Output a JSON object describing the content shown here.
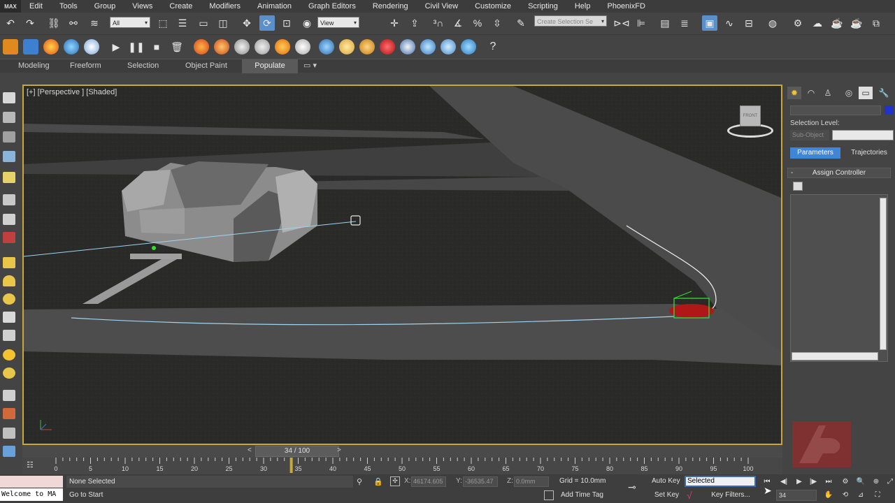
{
  "app": {
    "logo_text": "MAX"
  },
  "menu": [
    "Edit",
    "Tools",
    "Group",
    "Views",
    "Create",
    "Modifiers",
    "Animation",
    "Graph Editors",
    "Rendering",
    "Civil View",
    "Customize",
    "Scripting",
    "Help",
    "PhoenixFD"
  ],
  "toolbar": {
    "selection_filter": "All",
    "reference_coord": "View",
    "named_selection_placeholder": "Create Selection Se"
  },
  "ribbon": {
    "tabs": [
      "Modeling",
      "Freeform",
      "Selection",
      "Object Paint",
      "Populate"
    ],
    "active_tab": "Populate"
  },
  "viewport": {
    "label": "[+] [Perspective ] [Shaded]",
    "viewcube_label": "FRONT"
  },
  "command_panel": {
    "selection_level_label": "Selection Level:",
    "sub_object_label": "Sub-Object",
    "tab_parameters": "Parameters",
    "tab_trajectories": "Trajectories",
    "rollout_minus": "-",
    "rollout_title": "Assign Controller",
    "object_color": "#2233cc"
  },
  "timeline": {
    "position_label": "34 / 100",
    "current_frame": 34,
    "total_frames": 100,
    "prev_arrow": "<",
    "next_arrow": ">",
    "ticks": [
      "0",
      "5",
      "10",
      "15",
      "20",
      "25",
      "30",
      "35",
      "40",
      "45",
      "50",
      "55",
      "60",
      "65",
      "70",
      "75",
      "80",
      "85",
      "90",
      "95",
      "100"
    ]
  },
  "status": {
    "maxscript_text": "Welcome to MA",
    "selection_status": "None Selected",
    "prompt": "Go to Start",
    "x_label": "X:",
    "x_value": "46174.605",
    "y_label": "Y:",
    "y_value": "-36535.47",
    "z_label": "Z:",
    "z_value": "0.0mm",
    "grid": "Grid = 10.0mm",
    "add_time_tag": "Add Time Tag",
    "auto_key": "Auto Key",
    "auto_key_mode": "Selected",
    "set_key": "Set Key",
    "key_filters": "Key Filters...",
    "frame": "34"
  },
  "colors": {
    "accent": "#3f86d8",
    "viewport_border": "#c8a83a",
    "path_spline": "#9fd4ef",
    "selected_object": "#33dd33",
    "car": "#b01818"
  }
}
